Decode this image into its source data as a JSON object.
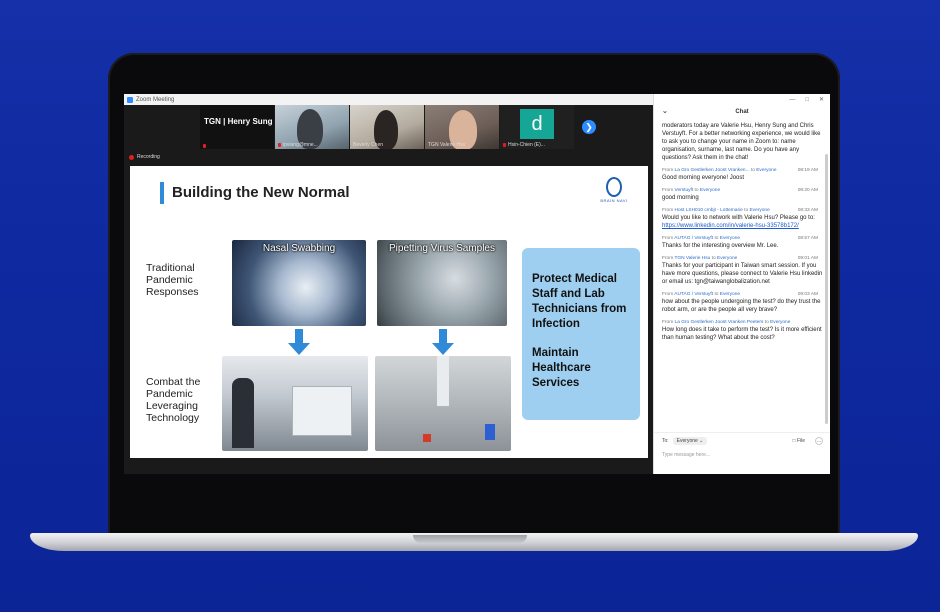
{
  "window": {
    "title": "Zoom Meeting",
    "controls": [
      "—",
      "□",
      "✕"
    ]
  },
  "video": {
    "host_label": "TGN | Henry Sung",
    "tiles": [
      {
        "name": ""
      },
      {
        "name": "ipviang@mne..."
      },
      {
        "name": "Beverly Chen"
      },
      {
        "name": "TGN Valerie Hsu"
      },
      {
        "name": "Hsin-Chien (E)...",
        "avatar": "d"
      }
    ],
    "next_icon": "❯"
  },
  "recording": {
    "label": "Recording"
  },
  "slide": {
    "title": "Building the New Normal",
    "logo_text": "BRAIN NAVI",
    "row1_label": "Traditional Pandemic Responses",
    "row2_label": "Combat the Pandemic Leveraging Technology",
    "photo1_caption": "Nasal Swabbing",
    "photo2_caption": "Pipetting Virus Samples",
    "box_text1": "Protect Medical Staff and Lab Technicians from Infection",
    "box_text2": "Maintain Healthcare Services"
  },
  "chat": {
    "title": "Chat",
    "collapse_icon": "⌄",
    "messages": [
      {
        "from": "",
        "to": "",
        "time": "",
        "body": "moderators today are Valerie Hsu, Henry Sung and Chris Verstuyft. For a better networking experience, we would like to ask you to change your name in Zoom to: name organisation, surname, last name. Do you have any questions? Ask them in the chat!"
      },
      {
        "from": "La Gro Gestlerken Joost Vranken...",
        "to": "Everyone",
        "time": "08:19 AM",
        "body": "Good morning everyone! Joost"
      },
      {
        "from": "Verstuyft",
        "to": "Everyone",
        "time": "08:20 AM",
        "body": "good morning"
      },
      {
        "from": "Host LSH010 cmbjt - Lottemarie",
        "to": "Everyone",
        "time": "08:33 AM",
        "body": "Would you like to network with Valerie Hsu? Please go to:",
        "link": "https://www.linkedin.com/in/valerie-hsu-33578b172/"
      },
      {
        "from": "AUTAG / Verstuyft",
        "to": "Everyone",
        "time": "08:57 AM",
        "body": "Thanks for the interesting overview Mr. Lee."
      },
      {
        "from": "TGN Valerie Hsu",
        "to": "Everyone",
        "time": "09:01 AM",
        "body": "Thanks for your participant in Taiwan smart session. If you have more questions, please connect to Valerie Hsu linkedin or email us: tgn@taiwanglobalization.net"
      },
      {
        "from": "AUTAG / Verstuyft",
        "to": "Everyone",
        "time": "09:03 AM",
        "body": "how about the people undergoing the test? do they trust the robot arm, or are the people all very brave?"
      },
      {
        "from": "La Gro Gestlerken Joost Vranken Peeters",
        "to": "Everyone",
        "time": "",
        "body": "How long does it take to perform the test? Is it more efficient than human testing? What about the cost?"
      }
    ],
    "from_prefix": "From",
    "to_word": "to",
    "to_label": "To:",
    "recipient": "Everyone ⌄",
    "file_label": "File",
    "more_label": "…",
    "placeholder": "Type message here..."
  }
}
